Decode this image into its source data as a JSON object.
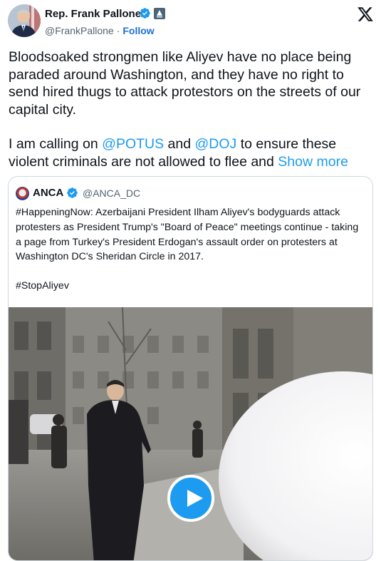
{
  "author": {
    "name": "Rep. Frank Pallone",
    "handle": "@FrankPallone",
    "separator": "·",
    "follow_label": "Follow"
  },
  "tweet": {
    "paragraph1": "Bloodsoaked strongmen like Aliyev have no place being paraded around Washington, and they have no right to send hired thugs to attack protestors on the streets of our capital city.",
    "p2_before": "I am calling on ",
    "mention1": "@POTUS",
    "p2_and": " and ",
    "mention2": "@DOJ",
    "p2_after": " to ensure these violent criminals are not allowed to flee and ",
    "show_more": "Show more"
  },
  "quote": {
    "name": "ANCA",
    "handle": "@ANCA_DC",
    "text": "#HappeningNow: Azerbaijani President Ilham Aliyev's bodyguards attack protesters as President Trump's \"Board of Peace\" meetings continue - taking a page from Turkey's President Erdogan's assault order on protesters at Washington DC's Sheridan Circle in 2017.",
    "hashtag": "#StopAliyev"
  },
  "icons": {
    "verified_color": "#1d9bf0",
    "x_logo": "x-logo-icon",
    "play": "play-icon"
  }
}
